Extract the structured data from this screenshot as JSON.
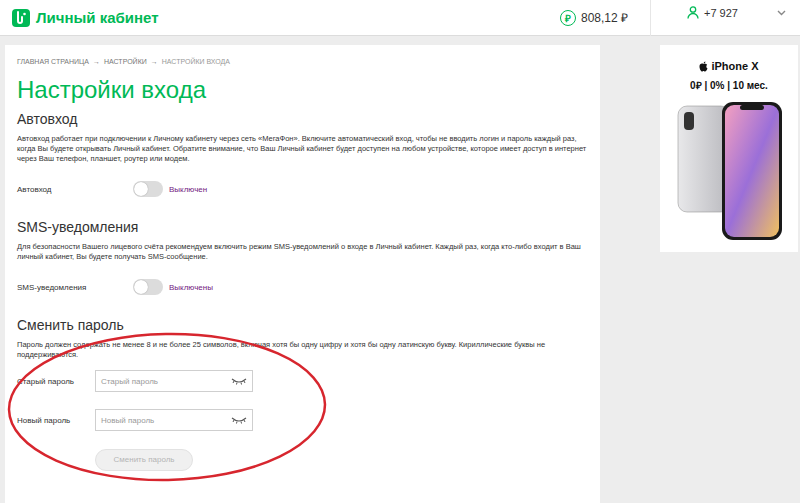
{
  "header": {
    "logo": "Личный кабинет",
    "balance_icon": "₽",
    "balance": "808,12 ₽",
    "phone": "+7 927"
  },
  "breadcrumbs": {
    "items": [
      "ГЛАВНАЯ СТРАНИЦА",
      "НАСТРОЙКИ",
      "НАСТРОЙКИ ВХОДА"
    ],
    "separator": "→"
  },
  "title": "Настройки входа",
  "sections": [
    {
      "heading": "Автовход",
      "text": "Автовход работает при подключении к Личному кабинету через сеть «МегаФон». Включите автоматический вход, чтобы не вводить логин и пароль каждый раз, когда Вы будете открывать Личный кабинет. Обратите внимание, что Ваш Личный кабинет будет доступен на любом устройстве, которое имеет доступ в интернет через Ваш телефон, планшет, роутер или модем.",
      "toggle": {
        "label": "Автовход",
        "on": false,
        "status": "Выключен"
      }
    },
    {
      "heading": "SMS-уведомления",
      "text": "Для безопасности Вашего лицевого счёта рекомендуем включить режим SMS-уведомлений о входе в Личный кабинет. Каждый раз, когда кто-либо входит в Ваш личный кабинет, Вы будете получать SMS-сообщение.",
      "toggle": {
        "label": "SMS-уведомления",
        "on": false,
        "status": "Выключены"
      }
    }
  ],
  "password": {
    "heading": "Сменить пароль",
    "text": "Пароль должен содержать не менее 8 и не более 25 символов, включая хотя бы одну цифру и хотя бы одну латинскую букву. Кириллические буквы не поддерживаются.",
    "fields": [
      {
        "label": "Старый пароль",
        "placeholder": "Старый пароль"
      },
      {
        "label": "Новый пароль",
        "placeholder": "Новый пароль"
      }
    ],
    "button": {
      "label": "Сменить пароль",
      "disabled": true
    }
  },
  "ad": {
    "title": "iPhone X",
    "offer": "0₽ | 0% | 10 мес."
  }
}
